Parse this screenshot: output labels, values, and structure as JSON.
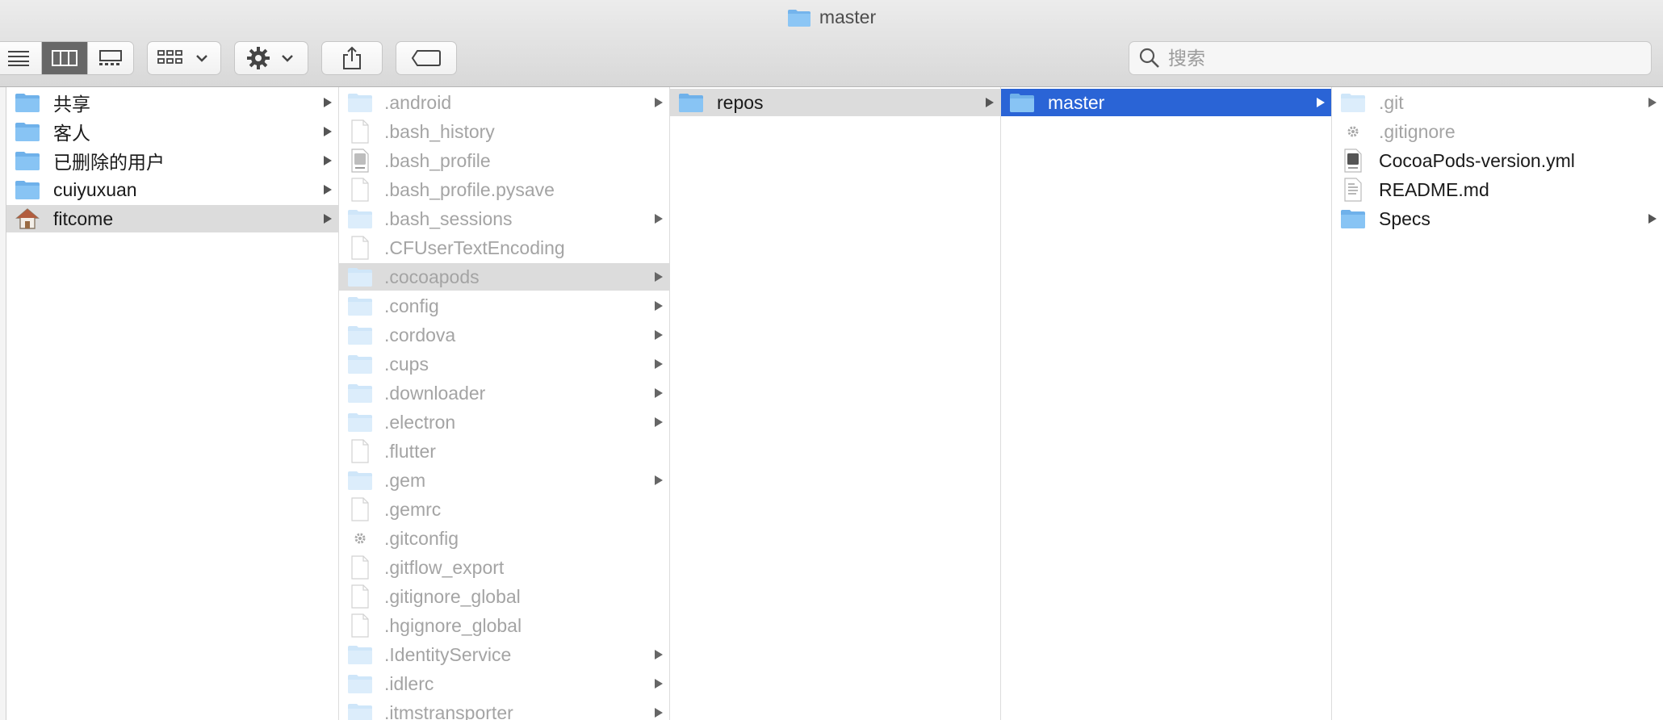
{
  "window": {
    "title": "master"
  },
  "toolbar": {
    "view_modes": [
      "list-view",
      "column-view",
      "gallery-view"
    ],
    "active_view": "column-view",
    "group_button": "group-by-icon",
    "action_button": "gear-icon",
    "share_button": "share-icon",
    "tag_button": "tag-icon"
  },
  "search": {
    "placeholder": "搜索",
    "value": ""
  },
  "colors": {
    "selection_blue": "#2a64d6",
    "selection_gray": "#dcdcdc",
    "folder": "#79b8ef"
  },
  "columns": [
    {
      "items": [
        {
          "label": "共享",
          "icon": "folder-icon",
          "has_children": true,
          "dim": false
        },
        {
          "label": "客人",
          "icon": "folder-icon",
          "has_children": true,
          "dim": false
        },
        {
          "label": "已删除的用户",
          "icon": "folder-icon",
          "has_children": true,
          "dim": false
        },
        {
          "label": "cuiyuxuan",
          "icon": "folder-icon",
          "has_children": true,
          "dim": false
        },
        {
          "label": "fitcome",
          "icon": "home-icon",
          "has_children": true,
          "dim": false,
          "selected": "gray"
        }
      ]
    },
    {
      "items": [
        {
          "label": ".android",
          "icon": "folder-icon",
          "has_children": true,
          "dim": true
        },
        {
          "label": ".bash_history",
          "icon": "file-icon",
          "has_children": false,
          "dim": true
        },
        {
          "label": ".bash_profile",
          "icon": "script-file-icon",
          "has_children": false,
          "dim": true
        },
        {
          "label": ".bash_profile.pysave",
          "icon": "file-icon",
          "has_children": false,
          "dim": true
        },
        {
          "label": ".bash_sessions",
          "icon": "folder-icon",
          "has_children": true,
          "dim": true
        },
        {
          "label": ".CFUserTextEncoding",
          "icon": "file-icon",
          "has_children": false,
          "dim": true
        },
        {
          "label": ".cocoapods",
          "icon": "folder-icon",
          "has_children": true,
          "dim": true,
          "selected": "gray"
        },
        {
          "label": ".config",
          "icon": "folder-icon",
          "has_children": true,
          "dim": true
        },
        {
          "label": ".cordova",
          "icon": "folder-icon",
          "has_children": true,
          "dim": true
        },
        {
          "label": ".cups",
          "icon": "folder-icon",
          "has_children": true,
          "dim": true
        },
        {
          "label": ".downloader",
          "icon": "folder-icon",
          "has_children": true,
          "dim": true
        },
        {
          "label": ".electron",
          "icon": "folder-icon",
          "has_children": true,
          "dim": true
        },
        {
          "label": ".flutter",
          "icon": "file-icon",
          "has_children": false,
          "dim": true
        },
        {
          "label": ".gem",
          "icon": "folder-icon",
          "has_children": true,
          "dim": true
        },
        {
          "label": ".gemrc",
          "icon": "file-icon",
          "has_children": false,
          "dim": true
        },
        {
          "label": ".gitconfig",
          "icon": "gear-file-icon",
          "has_children": false,
          "dim": true
        },
        {
          "label": ".gitflow_export",
          "icon": "file-icon",
          "has_children": false,
          "dim": true
        },
        {
          "label": ".gitignore_global",
          "icon": "file-icon",
          "has_children": false,
          "dim": true
        },
        {
          "label": ".hgignore_global",
          "icon": "file-icon",
          "has_children": false,
          "dim": true
        },
        {
          "label": ".IdentityService",
          "icon": "folder-icon",
          "has_children": true,
          "dim": true
        },
        {
          "label": ".idlerc",
          "icon": "folder-icon",
          "has_children": true,
          "dim": true
        },
        {
          "label": ".itmstransporter",
          "icon": "folder-icon",
          "has_children": true,
          "dim": true
        }
      ]
    },
    {
      "items": [
        {
          "label": "repos",
          "icon": "folder-icon",
          "has_children": true,
          "dim": false,
          "selected": "gray"
        }
      ]
    },
    {
      "items": [
        {
          "label": "master",
          "icon": "folder-icon",
          "has_children": true,
          "dim": false,
          "selected": "blue"
        }
      ]
    },
    {
      "items": [
        {
          "label": ".git",
          "icon": "folder-icon",
          "has_children": true,
          "dim": true
        },
        {
          "label": ".gitignore",
          "icon": "gear-file-icon",
          "has_children": false,
          "dim": true
        },
        {
          "label": "CocoaPods-version.yml",
          "icon": "script-file-icon",
          "has_children": false,
          "dim": false
        },
        {
          "label": "README.md",
          "icon": "text-file-icon",
          "has_children": false,
          "dim": false
        },
        {
          "label": "Specs",
          "icon": "folder-icon",
          "has_children": true,
          "dim": false
        }
      ]
    }
  ]
}
